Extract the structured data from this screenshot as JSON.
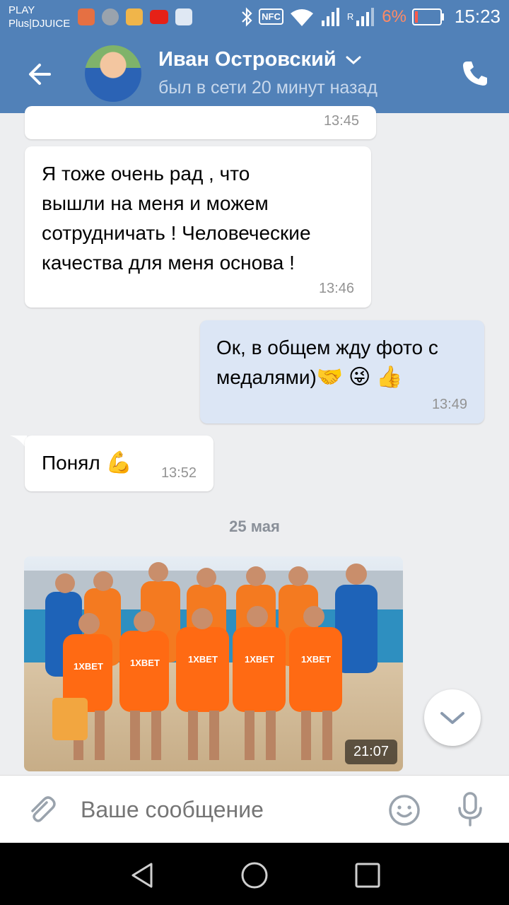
{
  "status_bar": {
    "carrier_line1": "PLAY",
    "carrier_line2": "Plus|DJUICE",
    "nfc": "NFC",
    "network_r": "R",
    "battery_percent": "6%",
    "clock": "15:23"
  },
  "header": {
    "contact_name": "Иван Островский",
    "last_seen": "был в сети 20 минут назад"
  },
  "messages": [
    {
      "direction": "in",
      "text": "",
      "time": "13:45"
    },
    {
      "direction": "in",
      "lines": [
        "Я тоже очень рад , что",
        "вышли на меня и можем",
        "сотрудничать ! Человеческие",
        "качества для меня основа !"
      ],
      "time": "13:46"
    },
    {
      "direction": "out",
      "lines": [
        "Ок, в общем жду фото с",
        "медалями)"
      ],
      "emojis": [
        "🤝",
        "😜",
        "👍"
      ],
      "time": "13:49"
    },
    {
      "direction": "in",
      "text": "Понял",
      "emojis": [
        "💪"
      ],
      "time": "13:52"
    }
  ],
  "date_separator": "25 мая",
  "photo_message": {
    "time": "21:07",
    "brand_text": "1XBET"
  },
  "composer": {
    "placeholder": "Ваше сообщение"
  },
  "colors": {
    "accent": "#5181b8",
    "outgoing_bubble": "#dce6f5",
    "background": "#edeef0"
  }
}
